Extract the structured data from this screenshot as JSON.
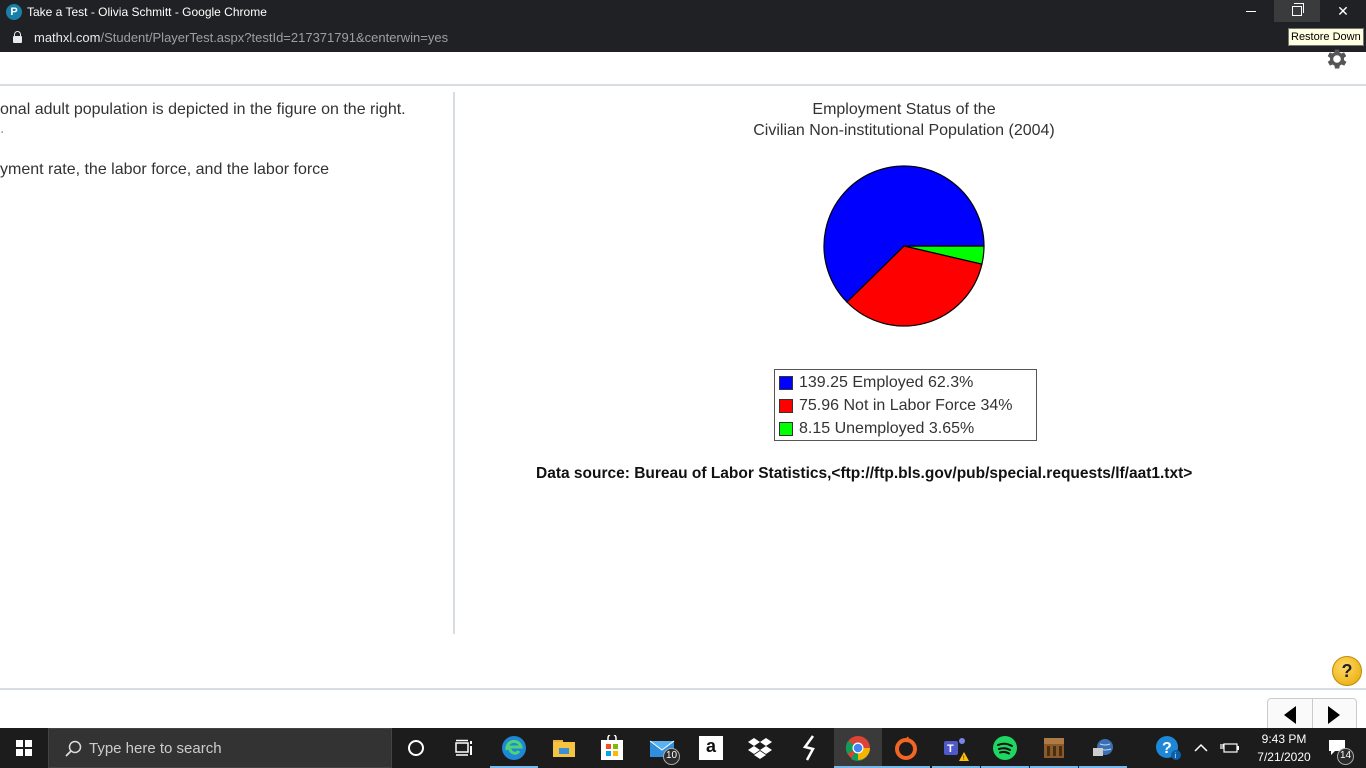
{
  "browser": {
    "window_title": "Take a Test - Olivia Schmitt - Google Chrome",
    "favicon_letter": "P",
    "url_host": "mathxl.com",
    "url_path": "/Student/PlayerTest.aspx?testId=217371791&centerwin=yes",
    "tooltip": "Restore Down",
    "controls": {
      "minimize": "minimize",
      "restore": "restore-down",
      "close": "✕"
    }
  },
  "question": {
    "line1": "onal adult population is depicted in the figure on the right.",
    "line1b": ".",
    "line2": "yment rate, the labor force, and the labor force"
  },
  "chart_data": {
    "type": "pie",
    "title": "Employment Status of the",
    "subtitle": "Civilian Non-institutional Population (2004)",
    "unit": "millions",
    "legend_position": "bottom",
    "slices": [
      {
        "label": "Employed",
        "value": 139.25,
        "percent": 62.3,
        "color": "#0000ff",
        "legend_text": "139.25 Employed  62.3%"
      },
      {
        "label": "Not in Labor Force",
        "value": 75.96,
        "percent": 34,
        "color": "#ff0000",
        "legend_text": "75.96 Not in Labor Force 34%"
      },
      {
        "label": "Unemployed",
        "value": 8.15,
        "percent": 3.65,
        "color": "#00ff00",
        "legend_text": "8.15 Unemployed 3.65%"
      }
    ],
    "source": "Data source: Bureau of Labor Statistics,<ftp://ftp.bls.gov/pub/special.requests/lf/aat1.txt>"
  },
  "help_label": "?",
  "taskbar": {
    "search_placeholder": "Type here to search",
    "icons": [
      {
        "name": "cortana-icon",
        "badge": null
      },
      {
        "name": "task-view-icon",
        "badge": null
      },
      {
        "name": "edge-icon",
        "badge": null
      },
      {
        "name": "file-explorer-icon",
        "badge": null
      },
      {
        "name": "microsoft-store-icon",
        "badge": null
      },
      {
        "name": "mail-icon",
        "badge": "10"
      },
      {
        "name": "amazon-icon",
        "badge": null
      },
      {
        "name": "dropbox-icon",
        "badge": null
      },
      {
        "name": "app-s-icon",
        "badge": null
      },
      {
        "name": "chrome-icon",
        "badge": null
      },
      {
        "name": "origin-icon",
        "badge": null
      },
      {
        "name": "teams-icon",
        "badge": null
      },
      {
        "name": "spotify-icon",
        "badge": null
      },
      {
        "name": "minecraft-icon",
        "badge": null
      },
      {
        "name": "network-globe-icon",
        "badge": null
      }
    ],
    "time": "9:43 PM",
    "date": "7/21/2020",
    "notification_count": "14"
  }
}
